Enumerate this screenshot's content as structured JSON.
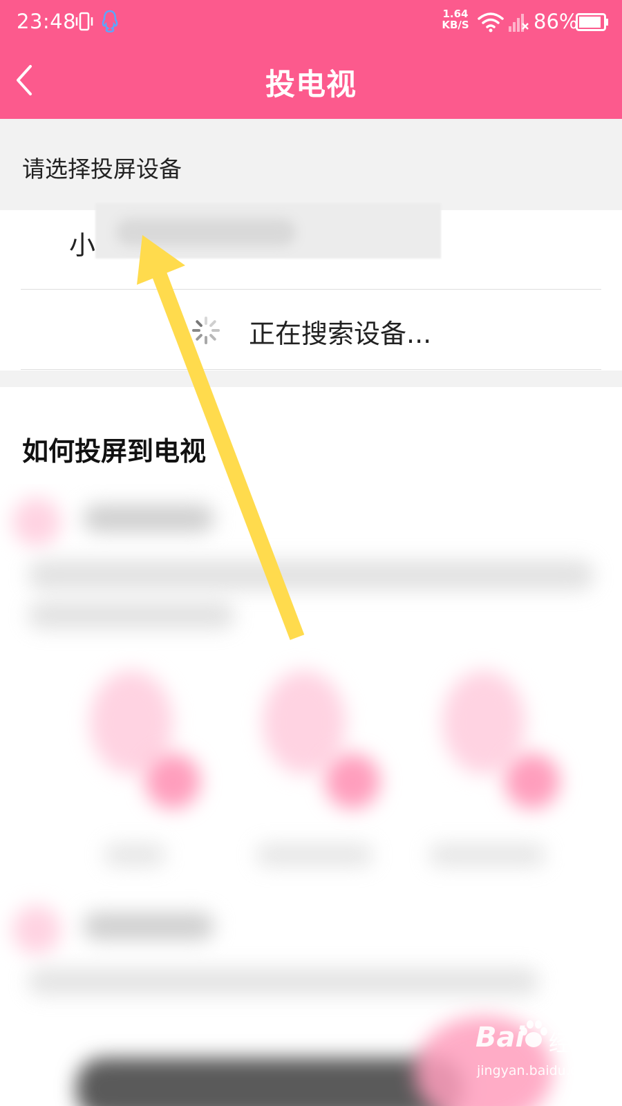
{
  "status_bar": {
    "time": "23:48",
    "net_speed_value": "1.64",
    "net_speed_unit": "KB/S",
    "battery": "86%"
  },
  "header": {
    "title": "投电视"
  },
  "device_section": {
    "label": "请选择投屏设备",
    "devices": [
      {
        "name_visible": "小"
      }
    ],
    "searching_text": "正在搜索设备..."
  },
  "howto": {
    "title": "如何投屏到电视"
  },
  "watermark": {
    "brand": "Bai",
    "brand_cn": "经验",
    "url": "jingyan.baidu.com"
  },
  "colors": {
    "accent": "#fc5a8d",
    "section_bg": "#f2f2f2",
    "arrow": "#ffdb4d"
  }
}
